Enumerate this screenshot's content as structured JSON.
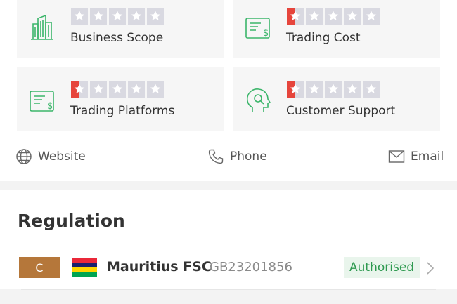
{
  "ratings": [
    {
      "label": "Business Scope",
      "icon": "building-icon",
      "score": 0
    },
    {
      "label": "Trading Cost",
      "icon": "bill-icon",
      "score": 0.5
    },
    {
      "label": "Trading Platforms",
      "icon": "bill-icon",
      "score": 0.5
    },
    {
      "label": "Customer Support",
      "icon": "support-head-icon",
      "score": 0.5
    }
  ],
  "contacts": {
    "website": "Website",
    "phone": "Phone",
    "email": "Email"
  },
  "regulation": {
    "title": "Regulation",
    "items": [
      {
        "grade": "C",
        "name": "Mauritius FSC",
        "license": "GB23201856",
        "status": "Authorised"
      }
    ]
  },
  "colors": {
    "star_empty": "#d9d9e1",
    "star_filled": "#e6453c",
    "icon_green": "#3bb56a",
    "grade_bg": "#b5773a",
    "status_bg": "#e9f5ec",
    "status_text": "#2e9a50"
  }
}
